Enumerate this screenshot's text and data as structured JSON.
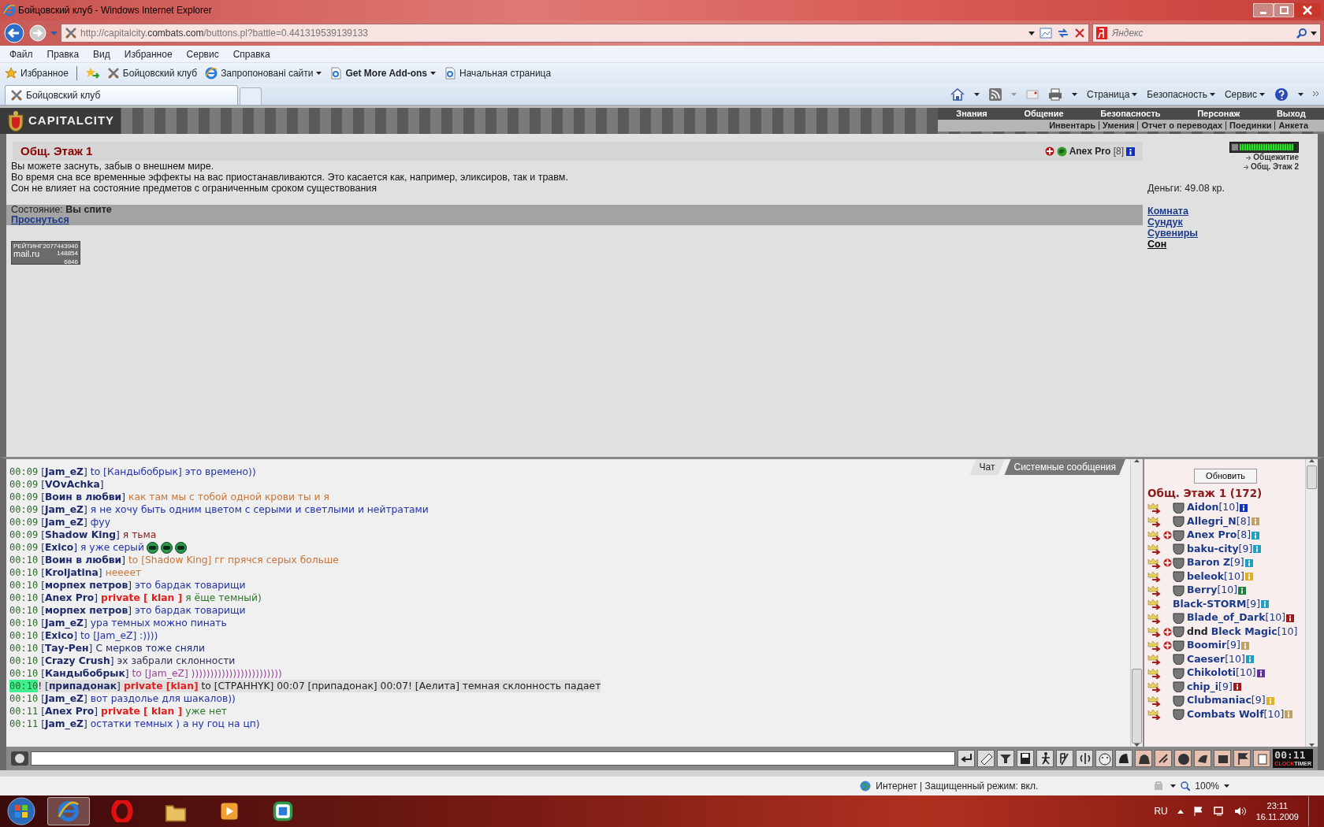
{
  "window": {
    "title": "Бойцовский клуб - Windows Internet Explorer"
  },
  "address_bar": {
    "url_start": "http://capitalcity.",
    "url_domain": "combats.com",
    "url_end": "/buttons.pl?battle=0.441319539139133"
  },
  "search": {
    "placeholder": "Яндекс"
  },
  "menu": [
    "Файл",
    "Правка",
    "Вид",
    "Избранное",
    "Сервис",
    "Справка"
  ],
  "favorites_bar": [
    {
      "label": "Избранное",
      "kind": "favorites",
      "bold": false,
      "dropdown": false
    },
    {
      "label": "Бойцовский клуб",
      "kind": "site",
      "bold": false,
      "dropdown": false
    },
    {
      "label": "Запропоновані сайти",
      "kind": "ie",
      "bold": false,
      "dropdown": true
    },
    {
      "label": "Get More Add-ons",
      "kind": "page",
      "bold": true,
      "dropdown": true
    },
    {
      "label": "Начальная страница",
      "kind": "page",
      "bold": false,
      "dropdown": false
    }
  ],
  "tabs": [
    {
      "label": "Бойцовский клуб",
      "selected": true
    }
  ],
  "command_bar": [
    "Страница",
    "Безопасность",
    "Сервис"
  ],
  "game": {
    "logo": "CAPITALCITY",
    "nav": [
      "Знания",
      "Общение",
      "Безопасность",
      "Персонаж",
      "Выход"
    ],
    "subnav": [
      "Инвентарь",
      "Умения",
      "Отчет о переводах",
      "Поединки",
      "Анкета"
    ],
    "room_title": "Общ. Этаж 1",
    "player": {
      "name": "Anex Pro",
      "level": "[8]"
    },
    "description": [
      "Вы можете заснуть, забыв о внешнем мире.",
      "Во время сна все временные эффекты на вас приостанавливаются. Это касается как, например, эликсиров, так и травм.",
      "Сон не влияет на состояние предметов с ограниченным сроком существования"
    ],
    "status_label": "Состояние:",
    "status_value": "Вы спите",
    "wake_link": "Проснуться",
    "counter": {
      "label": "РЕЙТИНГ",
      "total": "2077443940",
      "brand": "mail.ru",
      "hits": "148854",
      "hosts": "6846"
    },
    "health": {
      "level": 0.95
    },
    "exits": [
      "Общежитие",
      "Общ. Этаж 2"
    ],
    "money": "Деньги: 49.08 кр.",
    "room_links": [
      {
        "label": "Комната",
        "selected": false
      },
      {
        "label": "Сундук",
        "selected": false
      },
      {
        "label": "Сувениры",
        "selected": false
      },
      {
        "label": "Сон",
        "selected": true
      }
    ]
  },
  "chat": {
    "tabs": [
      {
        "label": "Чат",
        "selected": true
      },
      {
        "label": "Системные сообщения",
        "selected": false
      }
    ],
    "messages": [
      {
        "time": "00:09",
        "sender": "[**Jam_eZ**]",
        "text": "to [Кандыбобрык] это времено))",
        "color": "#2233aa",
        "highlight": false
      },
      {
        "time": "00:09",
        "sender": "[**VOvAchka**]",
        "highlight": false
      },
      {
        "time": "00:09",
        "sender": "[**Воин в любви**]",
        "text": "как там мы с тобой одной крови ты и я",
        "color": "#c8763a",
        "highlight": false
      },
      {
        "time": "00:09",
        "sender": "[**Jam_eZ**]",
        "text": "я не хочу быть одним цветом с серыми и светлыми и нейтратами",
        "color": "#2233aa",
        "highlight": false
      },
      {
        "time": "00:09",
        "sender": "[**Jam_eZ**]",
        "text": "фуу",
        "color": "#2233aa",
        "highlight": false
      },
      {
        "time": "00:09",
        "sender": "[**Shadow King**]",
        "text": "я тьма",
        "color": "#8a1c1c",
        "highlight": false
      },
      {
        "time": "00:09",
        "sender": "[**Exico**]",
        "text": "я уже серый",
        "color": "#2233aa",
        "highlight": false,
        "emotes": [
          {
            "kind": "smile"
          },
          {
            "kind": "smile"
          },
          {
            "kind": "smile"
          }
        ]
      },
      {
        "time": "00:10",
        "sender": "[**Воин в любви**]",
        "text": "to [Shadow King] гг прячся серых больше",
        "color": "#c8763a",
        "highlight": false
      },
      {
        "time": "00:10",
        "sender": "[**Kroljatina**]",
        "text": "неееет",
        "color": "#c8763a",
        "highlight": false
      },
      {
        "time": "00:10",
        "sender": "[**морпех петров**]",
        "text": "это бардак товарищи",
        "color": "#2233aa",
        "highlight": false
      },
      {
        "time": "00:10",
        "sender": "[**Anex Pro**]",
        "private": "private [ klan ]",
        "text": "я ёще темный)",
        "color": "#2a7a2a",
        "highlight": false
      },
      {
        "time": "00:10",
        "sender": "[**морпех петров**]",
        "text": "это бардак товарищи",
        "color": "#2233aa",
        "highlight": false
      },
      {
        "time": "00:10",
        "sender": "[**Jam_eZ**]",
        "text": "ура темных можно пинать",
        "color": "#2233aa",
        "highlight": false
      },
      {
        "time": "00:10",
        "sender": "[**Exico**]",
        "text": "to [Jam_eZ] :))))",
        "color": "#2233aa",
        "highlight": false
      },
      {
        "time": "00:10",
        "sender": "[**Тау-Рен**]",
        "text": "С мерков тоже сняли",
        "color": "#1f2a70",
        "highlight": false
      },
      {
        "time": "00:10",
        "sender": "[**Crazy Crush**]",
        "text": "эх забрали склонности",
        "color": "#333355",
        "highlight": false
      },
      {
        "time": "00:10",
        "sender": "[**Кандыбобрык**]",
        "text": "to [Jam_eZ] ))))))))))))))))))))))))",
        "color": "#a040a0",
        "highlight": false
      },
      {
        "time": "00:10",
        "flag": "!",
        "sender": "[**припадонак**]",
        "private": "private [klan]",
        "text": "to [СТРАННYK] 00:07 [припадонак] 00:07! [Аелита] темная склонность падает",
        "color": "#222222",
        "highlight": true
      },
      {
        "time": "00:10",
        "sender": "[**Jam_eZ**]",
        "text": "вот раздолье для шакалов))",
        "color": "#2233aa",
        "highlight": false
      },
      {
        "time": "00:11",
        "sender": "[**Anex Pro**]",
        "private": "private [ klan ]",
        "text": "уже нет",
        "color": "#2a7a2a",
        "highlight": false
      },
      {
        "time": "00:11",
        "sender": "[**Jam_eZ**]",
        "text": "остатки темных ) а ну гоц на цп)",
        "color": "#2233aa",
        "highlight": false
      }
    ]
  },
  "online": {
    "refresh": "Обновить",
    "title": "Общ. Этаж 1 (172)",
    "users": [
      {
        "name": "Aidon",
        "level": "[10]",
        "color": "#1030c0",
        "cross": false,
        "emblem": true
      },
      {
        "name": "Allegri_N",
        "level": "[8]",
        "color": "#c0a060",
        "cross": false,
        "emblem": true
      },
      {
        "name": "Anex Pro",
        "level": "[8]",
        "color": "#20a0c0",
        "cross": true,
        "emblem": true
      },
      {
        "name": "baku-city",
        "level": "[9]",
        "color": "#20a0c0",
        "cross": false,
        "emblem": true
      },
      {
        "name": "Baron Z",
        "level": "[9]",
        "color": "#20a0c0",
        "cross": true,
        "emblem": true
      },
      {
        "name": "beleok",
        "level": "[10]",
        "color": "#e0b020",
        "cross": false,
        "emblem": true
      },
      {
        "name": "Berry",
        "level": "[10]",
        "color": "#208040",
        "cross": false,
        "emblem": true
      },
      {
        "name": "Black-STORM",
        "level": "[9]",
        "color": "#20a0c0",
        "cross": false,
        "emblem": false
      },
      {
        "name": "Blade_of_Dark",
        "level": "[10]",
        "color": "#a01818",
        "cross": false,
        "emblem": true
      },
      {
        "prefix": "dnd",
        "name": "Bleck Magic",
        "level": "[10]",
        "cross": true,
        "emblem": true
      },
      {
        "name": "Boomir",
        "level": "[9]",
        "color": "#c0a060",
        "cross": true,
        "emblem": true
      },
      {
        "name": "Caeser",
        "level": "[10]",
        "color": "#20a0c0",
        "cross": false,
        "emblem": true
      },
      {
        "name": "Chikoloti",
        "level": "[10]",
        "color": "#6030a0",
        "cross": false,
        "emblem": true
      },
      {
        "name": "chip_i",
        "level": "[9]",
        "color": "#a01818",
        "cross": false,
        "emblem": true
      },
      {
        "name": "Clubmaniac",
        "level": "[9]",
        "color": "#e0b020",
        "cross": false,
        "emblem": true
      },
      {
        "name": "Combats Wolf",
        "level": "[10]",
        "color": "#c0a060",
        "cross": false,
        "emblem": true
      }
    ]
  },
  "clock": {
    "time": "00:11",
    "clock_label": "CLOCK",
    "timer_label": "TIMER"
  },
  "status_bar": {
    "zone": "Интернет | Защищенный режим: вкл.",
    "zoom": "100%"
  },
  "taskbar": {
    "language": "RU",
    "time": "23:11",
    "date": "16.11.2009",
    "apps": [
      {
        "kind": "ie",
        "selected": true
      },
      {
        "kind": "opera",
        "selected": false
      },
      {
        "kind": "folder",
        "selected": false
      },
      {
        "kind": "media",
        "selected": false
      },
      {
        "kind": "app",
        "selected": false
      }
    ]
  }
}
